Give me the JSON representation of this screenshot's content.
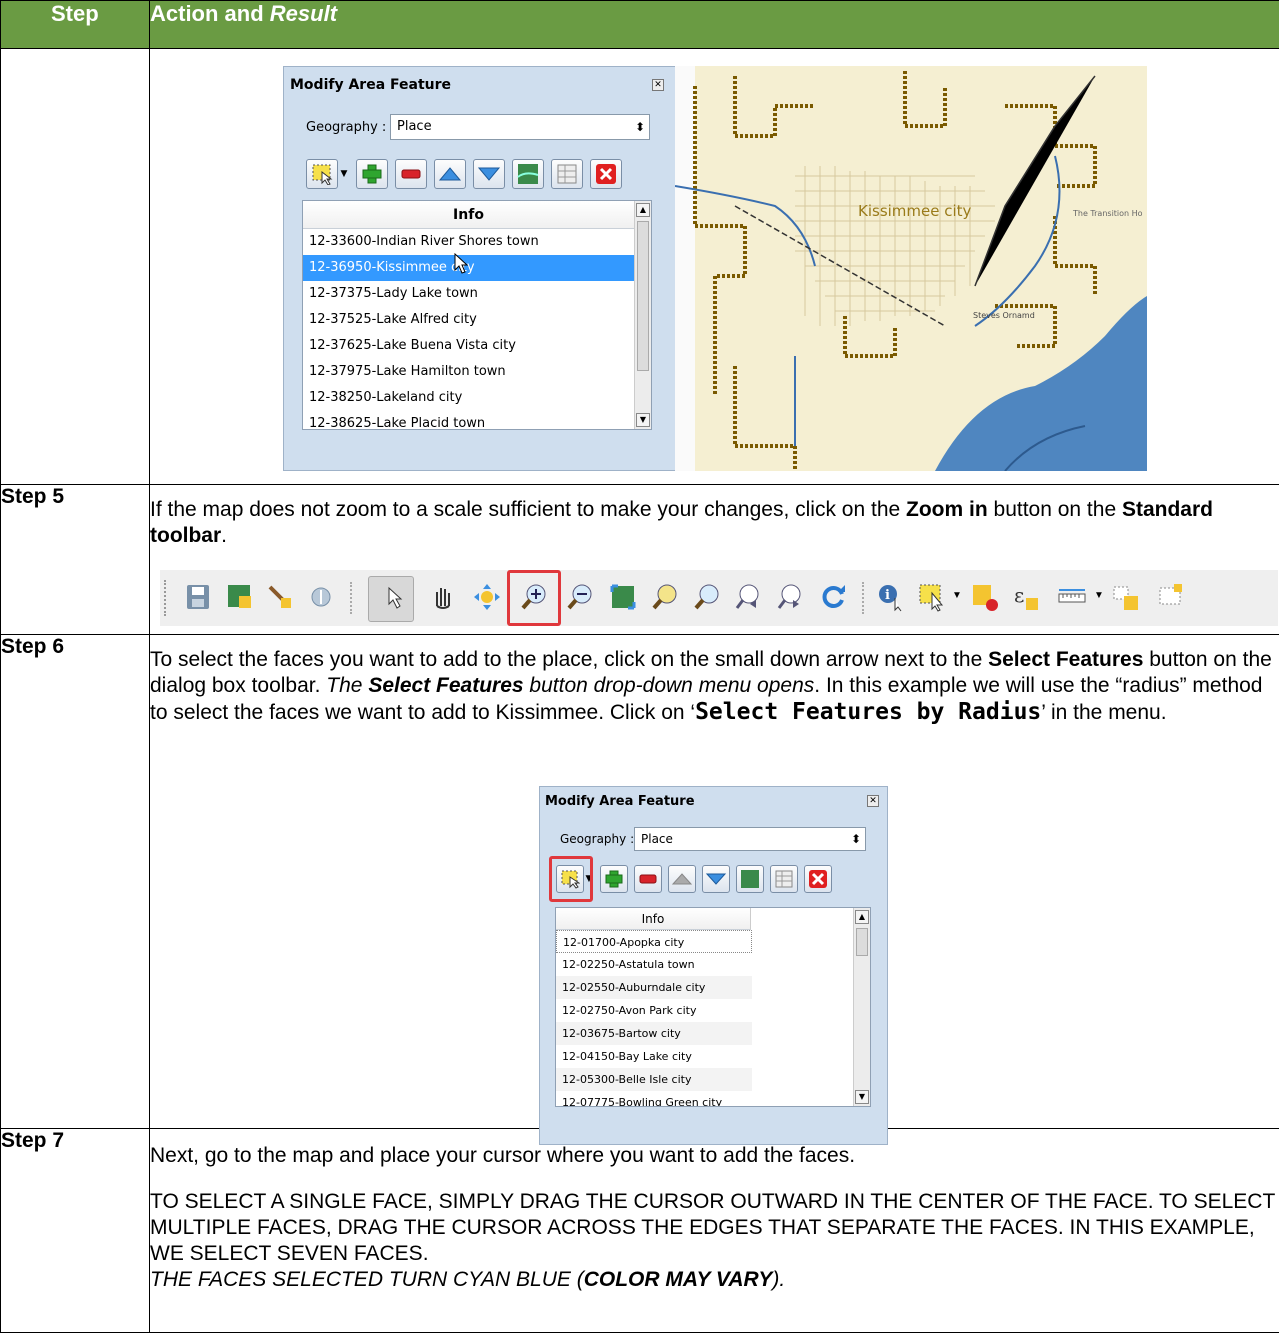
{
  "table": {
    "col_step": "Step",
    "col_action": "Action and ",
    "col_action_italic": "Result"
  },
  "dialog1": {
    "title": "Modify Area Feature",
    "geography_label": "Geography :",
    "geography_value": "Place",
    "list_header": "Info",
    "items": [
      "12-33600-Indian River Shores town",
      "12-36950-Kissimmee city",
      "12-37375-Lady Lake town",
      "12-37525-Lake Alfred city",
      "12-37625-Lake Buena Vista city",
      "12-37975-Lake Hamilton town",
      "12-38250-Lakeland city",
      "12-38625-Lake Placid town"
    ]
  },
  "map": {
    "label_kissimmee": "Kissimmee city",
    "label_transition": "The Transition Ho",
    "label_steves": "Steves Ornamd"
  },
  "step5": {
    "label": "Step 5",
    "t1": "If the map does not zoom to a scale sufficient to make your changes, click on the ",
    "b1": "Zoom in",
    "t2": " button on the ",
    "b2": "Standard toolbar",
    "t3": "."
  },
  "step6": {
    "label": "Step 6",
    "t1": "To select the faces you want to add to the place, click on the small down arrow next to the ",
    "b1": "Select Features",
    "t2": " button on the dialog box toolbar. ",
    "i1": "The ",
    "bi1": "Select Features",
    "i2": " button drop-down menu opens",
    "t3": ". In this example we will use the “radius” method to select the faces we want to add to Kissimmee. Click on ‘",
    "m1": "Select Features by Radius",
    "t4": "’ in the menu."
  },
  "dialog2": {
    "title": "Modify Area Feature",
    "geography_label": "Geography :",
    "geography_value": "Place",
    "list_header": "Info",
    "items": [
      "12-01700-Apopka city",
      "12-02250-Astatula town",
      "12-02550-Auburndale city",
      "12-02750-Avon Park city",
      "12-03675-Bartow city",
      "12-04150-Bay Lake city",
      "12-05300-Belle Isle city",
      "12-07775-Bowling Green city"
    ]
  },
  "step7": {
    "label": "Step 7",
    "p1": "Next, go to the map and place your cursor where you want to add the faces.",
    "p2": "TO SELECT A SINGLE FACE, SIMPLY DRAG THE CURSOR OUTWARD IN THE CENTER OF THE FACE. TO SELECT MULTIPLE FACES, DRAG THE CURSOR ACROSS THE EDGES THAT SEPARATE THE FACES. IN THIS EXAMPLE, WE SELECT SEVEN FACES.",
    "p3a": "THE FACES SELECTED TURN CYAN BLUE (",
    "p3b": "COLOR MAY VARY",
    "p3c": ")."
  },
  "icons": [
    "save-icon",
    "map-layer-icon",
    "brush-icon",
    "pan-to-icon",
    "select-pointer-icon",
    "pan-hand-icon",
    "zoom-full-icon",
    "zoom-in-icon",
    "zoom-out-icon",
    "zoom-extent-icon",
    "zoom-selection-icon",
    "zoom-layer-icon",
    "zoom-last-icon",
    "zoom-next-icon",
    "refresh-icon",
    "identify-icon",
    "select-features-icon",
    "deselect-icon",
    "expression-icon",
    "measure-icon",
    "add-feature-icon",
    "new-layer-icon"
  ]
}
